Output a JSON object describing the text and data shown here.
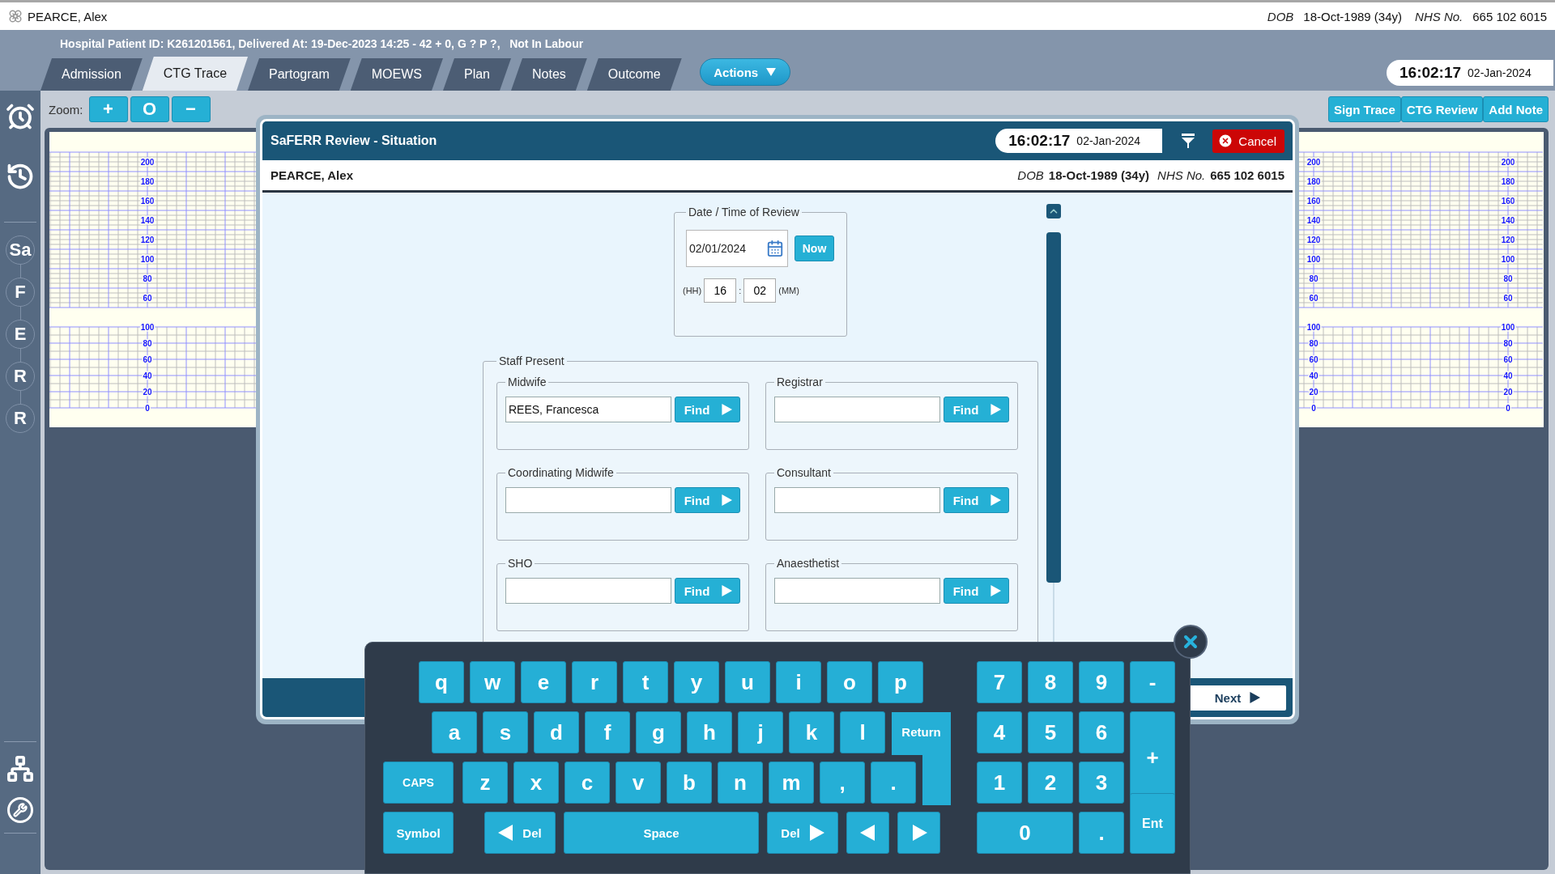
{
  "patient_header": {
    "name": "PEARCE, Alex",
    "dob_label": "DOB",
    "dob": "18-Oct-1989 (34y)",
    "nhs_label": "NHS No.",
    "nhs_number": "665 102 6015"
  },
  "info_line": "Hospital Patient ID: K261201561, Delivered At: 19-Dec-2023 14:25 - 42 + 0, G ? P ?,   Not In Labour",
  "tabs": [
    {
      "label": "Admission",
      "selected": false
    },
    {
      "label": "CTG Trace",
      "selected": true
    },
    {
      "label": "Partogram",
      "selected": false
    },
    {
      "label": "MOEWS",
      "selected": false
    },
    {
      "label": "Plan",
      "selected": false
    },
    {
      "label": "Notes",
      "selected": false
    },
    {
      "label": "Outcome",
      "selected": false
    }
  ],
  "actions_button": "Actions",
  "clock": {
    "time": "16:02:17",
    "date": "02-Jan-2024"
  },
  "sidebar": {
    "steps": [
      "Sa",
      "F",
      "E",
      "R",
      "R"
    ]
  },
  "zoom": {
    "label": "Zoom:",
    "buttons": [
      "+",
      "O",
      "−"
    ]
  },
  "trace_buttons": [
    "Sign Trace",
    "CTG Review",
    "Add Note"
  ],
  "trace_scales": [
    {
      "fhr_ticks": [
        "200",
        "180",
        "160",
        "140",
        "120",
        "100",
        "80",
        "60"
      ],
      "toco_ticks": [
        "100",
        "80",
        "60",
        "40",
        "20",
        "0"
      ]
    },
    {
      "fhr_ticks": [
        "200",
        "180",
        "160",
        "140",
        "120",
        "100",
        "80",
        "60"
      ],
      "toco_ticks": [
        "100",
        "80",
        "60",
        "40",
        "20",
        "0"
      ]
    },
    {
      "fhr_ticks": [
        "200",
        "180",
        "160",
        "140",
        "120",
        "100",
        "80",
        "60"
      ],
      "toco_ticks": [
        "100",
        "80",
        "60",
        "40",
        "20",
        "0"
      ]
    }
  ],
  "dialog": {
    "title": "SaFERR Review - Situation",
    "clock": {
      "time": "16:02:17",
      "date": "02-Jan-2024"
    },
    "cancel": "Cancel",
    "patient": {
      "name": "PEARCE, Alex",
      "dob_label": "DOB",
      "dob": "18-Oct-1989 (34y)",
      "nhs_label": "NHS No.",
      "nhs_number": "665 102 6015"
    },
    "review_time": {
      "legend": "Date / Time of Review",
      "date": "02/01/2024",
      "now_button": "Now",
      "hour_label": "(HH)",
      "hour": "16",
      "separator": ":",
      "minute": "02",
      "minute_label": "(MM)"
    },
    "staff": {
      "legend": "Staff Present",
      "roles": [
        {
          "label": "Midwife",
          "value": "REES, Francesca",
          "button": "Find"
        },
        {
          "label": "Registrar",
          "button": "Find"
        },
        {
          "label": "Coordinating Midwife",
          "button": "Find"
        },
        {
          "label": "Consultant",
          "button": "Find"
        },
        {
          "label": "SHO",
          "button": "Find"
        },
        {
          "label": "Anaesthetist",
          "button": "Find"
        }
      ]
    },
    "next_button": "Next"
  },
  "keyboard": {
    "letter_rows": [
      [
        "q",
        "w",
        "e",
        "r",
        "t",
        "y",
        "u",
        "i",
        "o",
        "p"
      ],
      [
        "a",
        "s",
        "d",
        "f",
        "g",
        "h",
        "j",
        "k",
        "l"
      ],
      [
        "z",
        "x",
        "c",
        "v",
        "b",
        "n",
        "m",
        ",",
        "."
      ]
    ],
    "caps": "CAPS",
    "return": "Return",
    "symbol": "Symbol",
    "delete_back": "Del",
    "space": "Space",
    "delete_forward": "Del",
    "numpad": [
      {
        "label": "7",
        "kind": "key"
      },
      {
        "label": "8",
        "kind": "key"
      },
      {
        "label": "9",
        "kind": "key"
      },
      {
        "label": "-",
        "kind": "key"
      },
      {
        "label": "4",
        "kind": "key"
      },
      {
        "label": "5",
        "kind": "key"
      },
      {
        "label": "6",
        "kind": "key"
      },
      {
        "label": "+",
        "kind": "tall"
      },
      {
        "label": "1",
        "kind": "key"
      },
      {
        "label": "2",
        "kind": "key"
      },
      {
        "label": "3",
        "kind": "key"
      },
      {
        "label": "0",
        "kind": "wide"
      },
      {
        "label": ".",
        "kind": "key"
      },
      {
        "label": "Ent",
        "kind": "raised"
      }
    ]
  }
}
